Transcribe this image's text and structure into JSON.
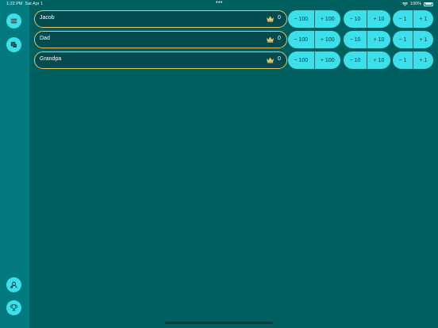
{
  "statusbar": {
    "time": "1:22 PM",
    "date": "Sat Apr 1",
    "dots": "•••",
    "battery_text": "100%"
  },
  "sidebar": {
    "top": [
      {
        "name": "menu-button",
        "icon": "hamburger-menu-icon"
      },
      {
        "name": "dice-button",
        "icon": "dice-icon"
      }
    ],
    "bottom": [
      {
        "name": "add-player-button",
        "icon": "person-add-icon"
      },
      {
        "name": "trophy-button",
        "icon": "trophy-icon"
      }
    ]
  },
  "players": [
    {
      "name": "Jacob",
      "score": "0"
    },
    {
      "name": "Dad",
      "score": "0"
    },
    {
      "name": "Grandpa",
      "score": "0"
    }
  ],
  "buttons": {
    "minus_100": "− 100",
    "plus_100": "+ 100",
    "minus_10": "− 10",
    "plus_10": "+ 10",
    "minus_1": "− 1",
    "plus_1": "+ 1"
  },
  "colors": {
    "background": "#005f5f",
    "sidebar": "#037a7f",
    "accent": "#3de0ea",
    "gold": "#e9c46a"
  }
}
